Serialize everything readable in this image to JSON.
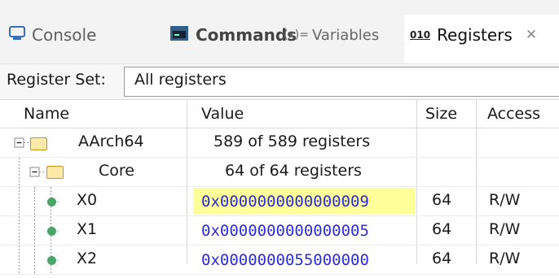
{
  "tabs": [
    {
      "label": "Console",
      "icon": "console-icon"
    },
    {
      "label": "Commands",
      "icon": "commands-icon"
    },
    {
      "label": "Variables",
      "icon": "variables-icon",
      "prefix": "(x)="
    },
    {
      "label": "Registers",
      "icon": "registers-icon",
      "prefix": "010"
    }
  ],
  "register_set": {
    "label": "Register Set:",
    "value": "All registers"
  },
  "columns": {
    "name": "Name",
    "value": "Value",
    "size": "Size",
    "access": "Access"
  },
  "rows": [
    {
      "name": "AArch64",
      "value": "589 of 589 registers",
      "size": "",
      "access": ""
    },
    {
      "name": "Core",
      "value": "64 of 64 registers",
      "size": "",
      "access": ""
    },
    {
      "name": "X0",
      "value": "0x0000000000000009",
      "size": "64",
      "access": "R/W"
    },
    {
      "name": "X1",
      "value": "0x0000000000000005",
      "size": "64",
      "access": "R/W"
    },
    {
      "name": "X2",
      "value": "0x0000000055000000",
      "size": "64",
      "access": "R/W"
    }
  ],
  "colors": {
    "highlight": "#ffff99",
    "hex_text": "#2a2ae0",
    "folder": "#ffe9a8",
    "status_dot": "#4aa568"
  }
}
